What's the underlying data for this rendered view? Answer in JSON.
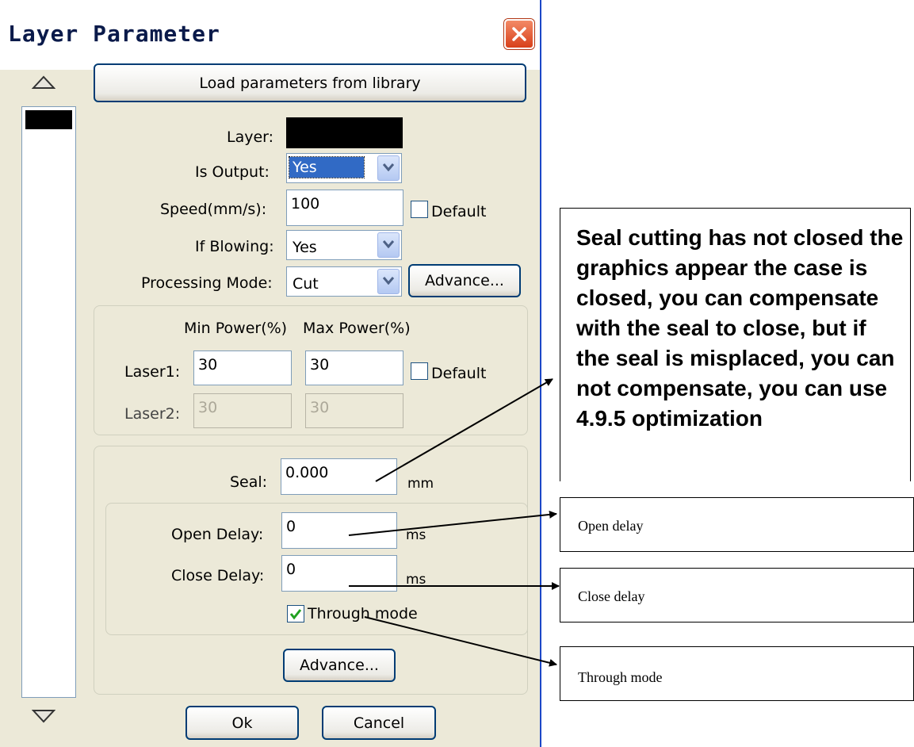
{
  "dialog": {
    "title": "Layer Parameter",
    "load_button": "Load parameters from library",
    "layer_label": "Layer:",
    "layer_color": "#000000",
    "is_output": {
      "label": "Is Output:",
      "value": "Yes"
    },
    "speed": {
      "label": "Speed(mm/s):",
      "value": "100",
      "default_label": "Default",
      "default_checked": false
    },
    "if_blowing": {
      "label": "If Blowing:",
      "value": "Yes"
    },
    "processing_mode": {
      "label": "Processing Mode:",
      "value": "Cut",
      "advance_button": "Advance..."
    },
    "power": {
      "min_header": "Min Power(%)",
      "max_header": "Max Power(%)",
      "laser1": {
        "label": "Laser1:",
        "min": "30",
        "max": "30"
      },
      "laser2": {
        "label": "Laser2:",
        "min": "30",
        "max": "30"
      },
      "default_label": "Default",
      "default_checked": false
    },
    "seal": {
      "label": "Seal:",
      "value": "0.000",
      "unit": "mm"
    },
    "open_delay": {
      "label": "Open Delay:",
      "value": "0",
      "unit": "ms"
    },
    "close_delay": {
      "label": "Close Delay:",
      "value": "0",
      "unit": "ms"
    },
    "through_mode": {
      "label": "Through mode",
      "checked": true
    },
    "advance_button": "Advance...",
    "ok_button": "Ok",
    "cancel_button": "Cancel"
  },
  "annotations": {
    "seal_note": "Seal cutting has not closed the graphics appear the case is closed, you can compensate with the seal to close, but if the seal is misplaced, you can not compensate, you can use 4.9.5 optimization",
    "open_delay_note": "Open delay",
    "close_delay_note": "Close delay",
    "through_mode_note": "Through mode"
  },
  "colors": {
    "title_close": "#d8401a",
    "selection": "#316ac5",
    "window_bg": "#ece9d8"
  }
}
